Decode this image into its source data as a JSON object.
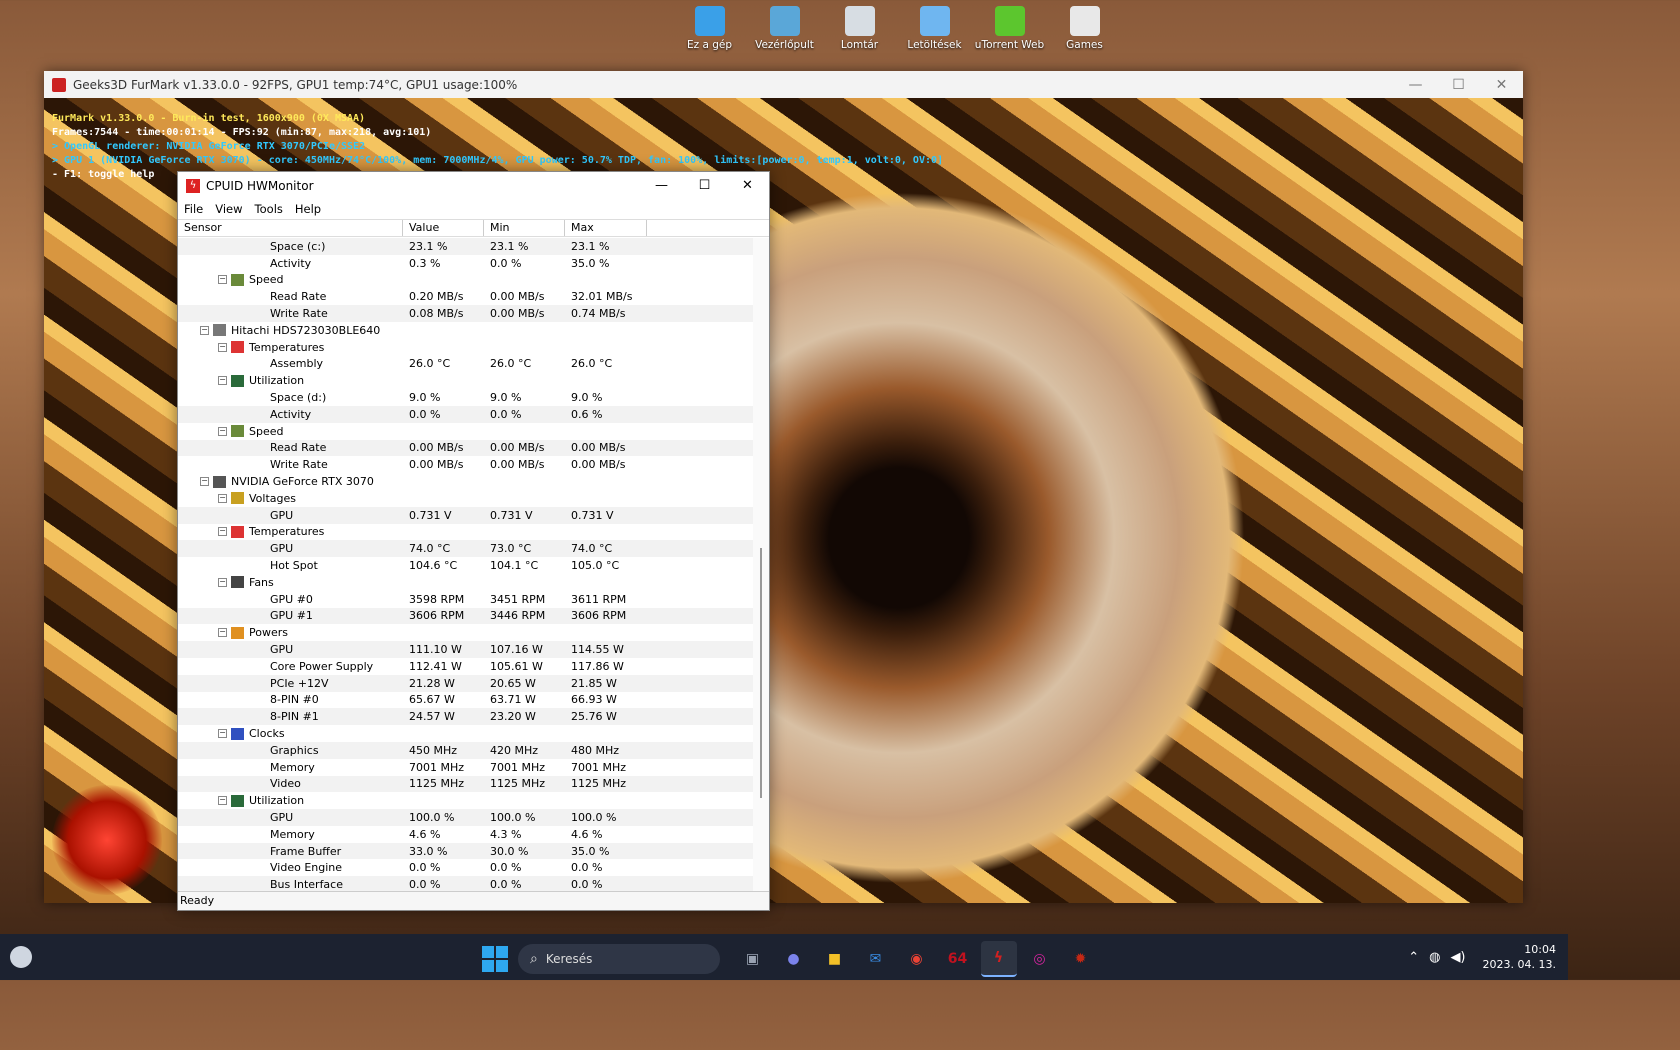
{
  "desktop": {
    "icons": [
      {
        "label": "Ez a gép",
        "icon": "computer-icon",
        "color": "#3aa0e8"
      },
      {
        "label": "Vezérlőpult",
        "icon": "control-panel-icon",
        "color": "#5aa7d8"
      },
      {
        "label": "Lomtár",
        "icon": "recycle-bin-icon",
        "color": "#d7dde3"
      },
      {
        "label": "Letöltések",
        "icon": "downloads-cloud-icon",
        "color": "#6fb6f0"
      },
      {
        "label": "uTorrent Web",
        "icon": "utorrent-icon",
        "color": "#5cc62e"
      },
      {
        "label": "Games",
        "icon": "games-icon",
        "color": "#e8e8e8"
      }
    ]
  },
  "furmark": {
    "window_title": "Geeks3D FurMark v1.33.0.0 - 92FPS, GPU1 temp:74°C, GPU1 usage:100%",
    "osd": [
      "FurMark v1.33.0.0 - Burn-in test, 1600x900 (0X MSAA)",
      "Frames:7544 - time:00:01:14 - FPS:92 (min:87, max:218, avg:101)",
      "> OpenGL renderer: NVIDIA GeForce RTX 3070/PCIe/SSE2",
      "> GPU 1 (NVIDIA GeForce RTX 3070) - core: 450MHz/74°C/100%, mem: 7000MHz/4%, GPU power: 50.7% TDP, fan: 100%, limits:[power:0, temp:1, volt:0, OV:0]",
      "- F1: toggle help"
    ]
  },
  "hwmonitor": {
    "title": "CPUID HWMonitor",
    "menu": [
      "File",
      "View",
      "Tools",
      "Help"
    ],
    "columns": [
      "Sensor",
      "Value",
      "Min",
      "Max"
    ],
    "status": "Ready",
    "rows": [
      {
        "level": 3,
        "name": "Space (c:)",
        "value": "23.1 %",
        "min": "23.1 %",
        "max": "23.1 %"
      },
      {
        "level": 3,
        "name": "Activity",
        "value": "0.3 %",
        "min": "0.0 %",
        "max": "35.0 %"
      },
      {
        "level": 2,
        "name": "Speed",
        "icon": "speed-gauge-icon"
      },
      {
        "level": 3,
        "name": "Read Rate",
        "value": "0.20 MB/s",
        "min": "0.00 MB/s",
        "max": "32.01 MB/s"
      },
      {
        "level": 3,
        "name": "Write Rate",
        "value": "0.08 MB/s",
        "min": "0.00 MB/s",
        "max": "0.74 MB/s"
      },
      {
        "level": 1,
        "name": "Hitachi HDS723030BLE640",
        "icon": "hard-drive-icon"
      },
      {
        "level": 2,
        "name": "Temperatures",
        "icon": "thermometer-icon"
      },
      {
        "level": 3,
        "name": "Assembly",
        "value": "26.0 °C",
        "min": "26.0 °C",
        "max": "26.0 °C"
      },
      {
        "level": 2,
        "name": "Utilization",
        "icon": "utilization-icon"
      },
      {
        "level": 3,
        "name": "Space (d:)",
        "value": "9.0 %",
        "min": "9.0 %",
        "max": "9.0 %"
      },
      {
        "level": 3,
        "name": "Activity",
        "value": "0.0 %",
        "min": "0.0 %",
        "max": "0.6 %"
      },
      {
        "level": 2,
        "name": "Speed",
        "icon": "speed-gauge-icon"
      },
      {
        "level": 3,
        "name": "Read Rate",
        "value": "0.00 MB/s",
        "min": "0.00 MB/s",
        "max": "0.00 MB/s"
      },
      {
        "level": 3,
        "name": "Write Rate",
        "value": "0.00 MB/s",
        "min": "0.00 MB/s",
        "max": "0.00 MB/s"
      },
      {
        "level": 1,
        "name": "NVIDIA GeForce RTX 3070",
        "icon": "graphics-card-icon"
      },
      {
        "level": 2,
        "name": "Voltages",
        "icon": "voltage-icon"
      },
      {
        "level": 3,
        "name": "GPU",
        "value": "0.731 V",
        "min": "0.731 V",
        "max": "0.731 V"
      },
      {
        "level": 2,
        "name": "Temperatures",
        "icon": "thermometer-icon"
      },
      {
        "level": 3,
        "name": "GPU",
        "value": "74.0 °C",
        "min": "73.0 °C",
        "max": "74.0 °C"
      },
      {
        "level": 3,
        "name": "Hot Spot",
        "value": "104.6 °C",
        "min": "104.1 °C",
        "max": "105.0 °C"
      },
      {
        "level": 2,
        "name": "Fans",
        "icon": "fan-icon"
      },
      {
        "level": 3,
        "name": "GPU #0",
        "value": "3598 RPM",
        "min": "3451 RPM",
        "max": "3611 RPM"
      },
      {
        "level": 3,
        "name": "GPU #1",
        "value": "3606 RPM",
        "min": "3446 RPM",
        "max": "3606 RPM"
      },
      {
        "level": 2,
        "name": "Powers",
        "icon": "power-icon"
      },
      {
        "level": 3,
        "name": "GPU",
        "value": "111.10 W",
        "min": "107.16 W",
        "max": "114.55 W"
      },
      {
        "level": 3,
        "name": "Core Power Supply",
        "value": "112.41 W",
        "min": "105.61 W",
        "max": "117.86 W"
      },
      {
        "level": 3,
        "name": "PCIe +12V",
        "value": "21.28 W",
        "min": "20.65 W",
        "max": "21.85 W"
      },
      {
        "level": 3,
        "name": "8-PIN #0",
        "value": "65.67 W",
        "min": "63.71 W",
        "max": "66.93 W"
      },
      {
        "level": 3,
        "name": "8-PIN #1",
        "value": "24.57 W",
        "min": "23.20 W",
        "max": "25.76 W"
      },
      {
        "level": 2,
        "name": "Clocks",
        "icon": "clock-bars-icon"
      },
      {
        "level": 3,
        "name": "Graphics",
        "value": "450 MHz",
        "min": "420 MHz",
        "max": "480 MHz"
      },
      {
        "level": 3,
        "name": "Memory",
        "value": "7001 MHz",
        "min": "7001 MHz",
        "max": "7001 MHz"
      },
      {
        "level": 3,
        "name": "Video",
        "value": "1125 MHz",
        "min": "1125 MHz",
        "max": "1125 MHz"
      },
      {
        "level": 2,
        "name": "Utilization",
        "icon": "utilization-icon"
      },
      {
        "level": 3,
        "name": "GPU",
        "value": "100.0 %",
        "min": "100.0 %",
        "max": "100.0 %"
      },
      {
        "level": 3,
        "name": "Memory",
        "value": "4.6 %",
        "min": "4.3 %",
        "max": "4.6 %"
      },
      {
        "level": 3,
        "name": "Frame Buffer",
        "value": "33.0 %",
        "min": "30.0 %",
        "max": "35.0 %"
      },
      {
        "level": 3,
        "name": "Video Engine",
        "value": "0.0 %",
        "min": "0.0 %",
        "max": "0.0 %"
      },
      {
        "level": 3,
        "name": "Bus Interface",
        "value": "0.0 %",
        "min": "0.0 %",
        "max": "0.0 %"
      }
    ]
  },
  "taskbar": {
    "search_label": "Keresés",
    "apps": [
      {
        "name": "task-view-icon",
        "glyph": "▣",
        "color": "#9aa3b2"
      },
      {
        "name": "teams-chat-icon",
        "glyph": "●",
        "color": "#7b83eb"
      },
      {
        "name": "file-explorer-icon",
        "glyph": "■",
        "color": "#f2c028"
      },
      {
        "name": "mail-icon",
        "glyph": "✉",
        "color": "#3a8ee6"
      },
      {
        "name": "chrome-icon",
        "glyph": "◉",
        "color": "#ea4335"
      },
      {
        "name": "aida64-icon",
        "glyph": "64",
        "color": "#c1121f"
      },
      {
        "name": "hwmonitor-icon",
        "glyph": "ϟ",
        "color": "#d32020"
      },
      {
        "name": "instagram-icon",
        "glyph": "◎",
        "color": "#d6249f"
      },
      {
        "name": "furmark-icon",
        "glyph": "✹",
        "color": "#c62814"
      }
    ],
    "time": "10:04",
    "date": "2023. 04. 13."
  }
}
